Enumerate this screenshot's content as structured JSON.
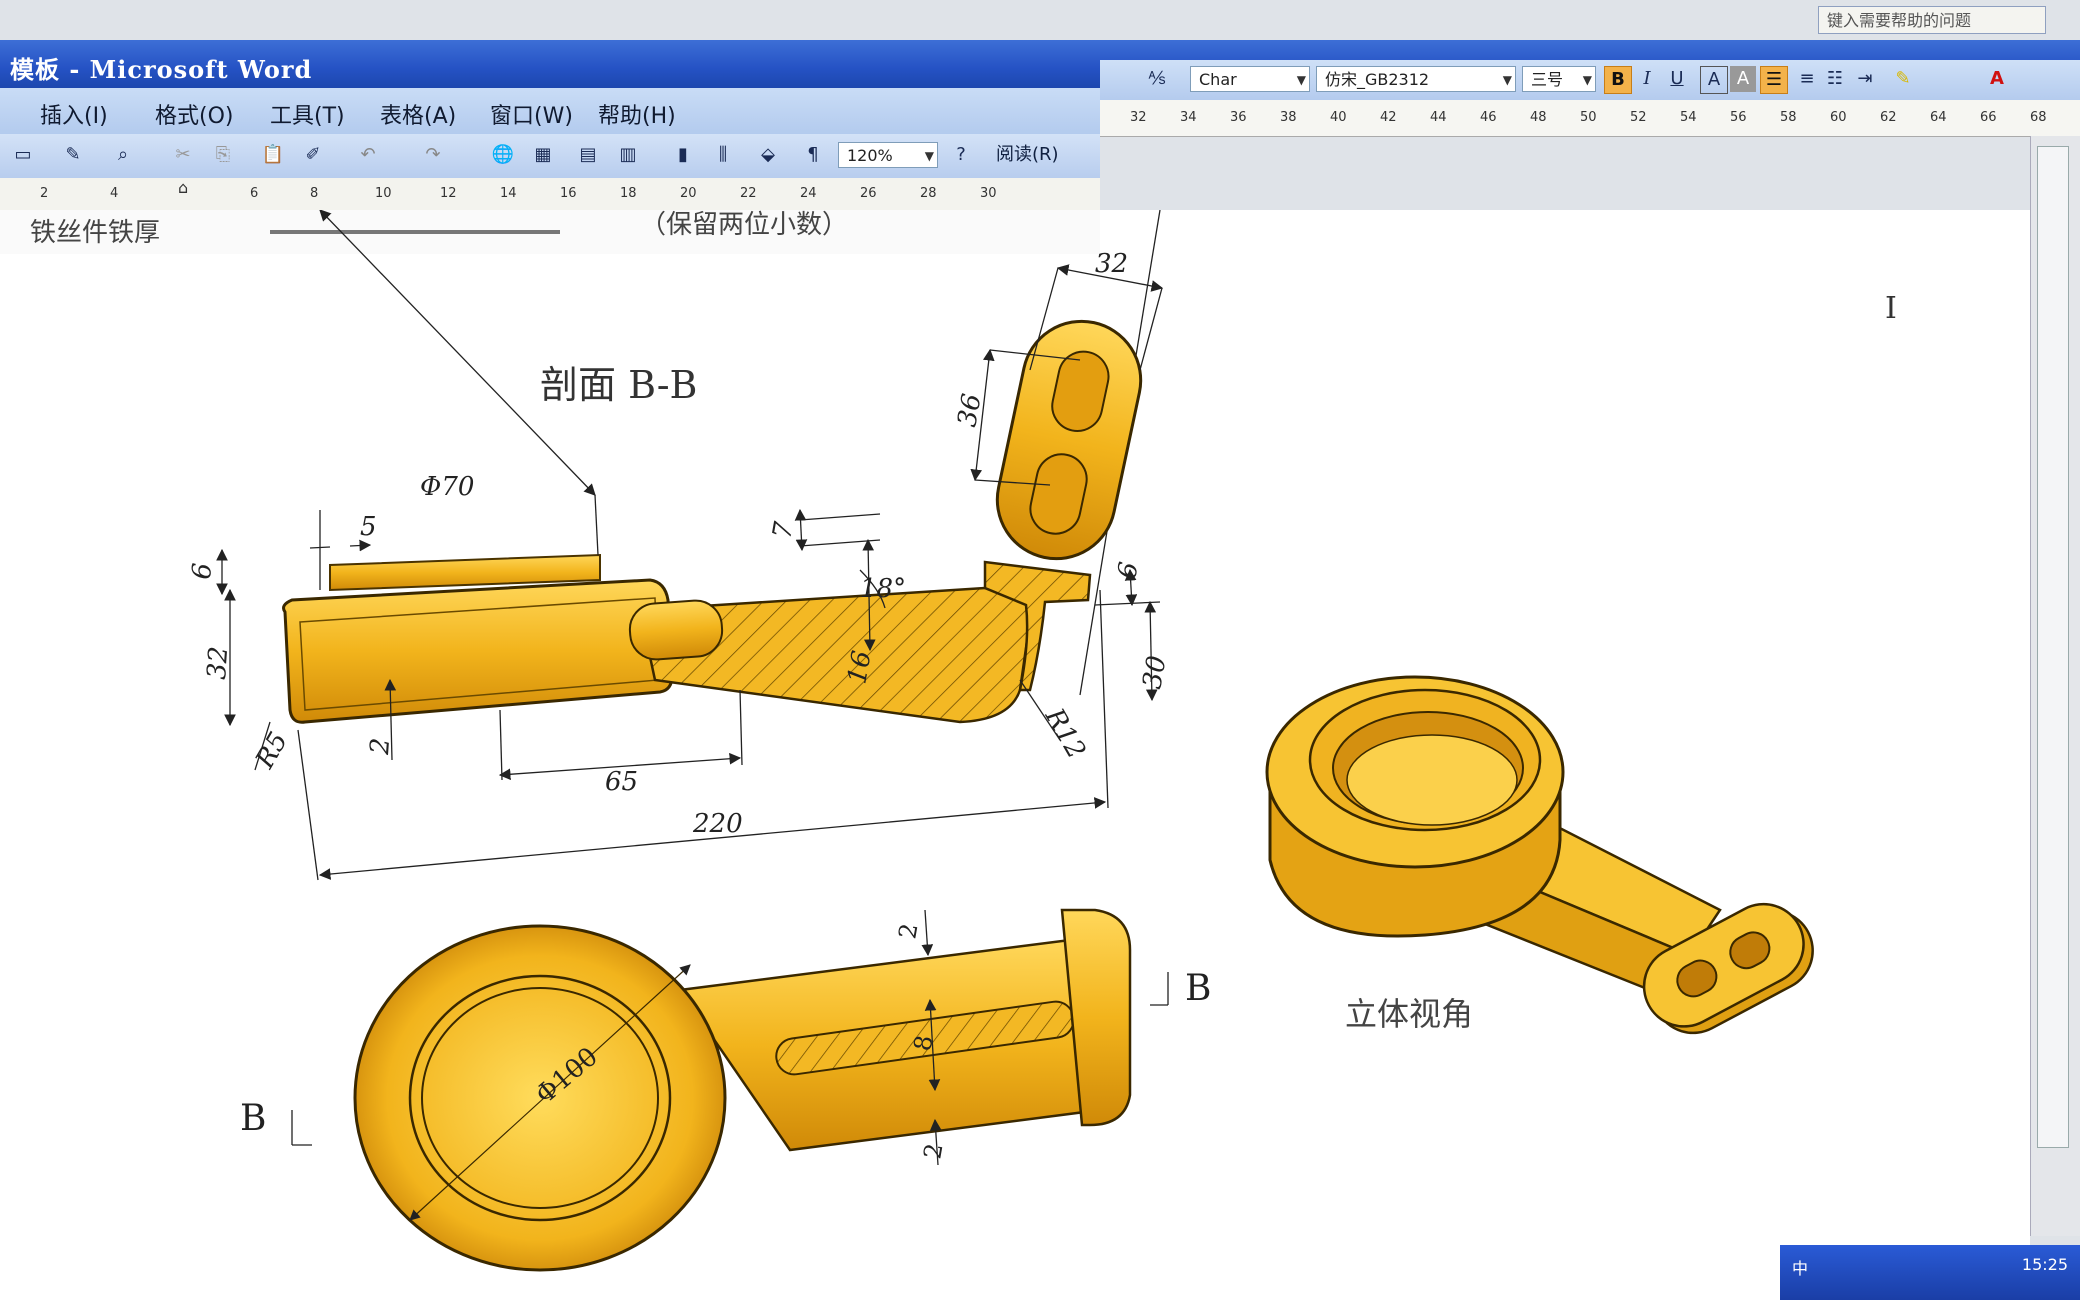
{
  "window": {
    "title": "模板 - Microsoft Word",
    "help_placeholder": "键入需要帮助的问题"
  },
  "menu": {
    "items": [
      "插入(I)",
      "格式(O)",
      "工具(T)",
      "表格(A)",
      "窗口(W)",
      "帮助(H)"
    ]
  },
  "format_toolbar": {
    "style": "Char",
    "font": "仿宋_GB2312",
    "size": "三号",
    "bold": "B",
    "italic": "I",
    "underline": "U",
    "char_border": "A",
    "char_shading": "A"
  },
  "standard_toolbar": {
    "zoom": "120%",
    "read_label": "阅读(R)"
  },
  "ruler_top": [
    "32",
    "34",
    "36",
    "38",
    "40",
    "42",
    "44",
    "46",
    "48",
    "50",
    "52",
    "54",
    "56",
    "58",
    "60",
    "62",
    "64",
    "66",
    "68"
  ],
  "ruler_left": [
    "2",
    "4",
    "6",
    "8",
    "10",
    "12",
    "14",
    "16",
    "18",
    "20",
    "22",
    "24",
    "26",
    "28",
    "30"
  ],
  "document": {
    "heading_fragment": "铁丝件铁厚",
    "note_fragment": "（保留两位小数）",
    "section_label": "剖面 B-B",
    "view_label": "立体视角",
    "cut_left": "B",
    "cut_right": "B"
  },
  "dimensions": {
    "d70": "Φ70",
    "d5": "5",
    "d6_left": "6",
    "d32_left": "32",
    "r5": "R5",
    "d2_left": "2",
    "d65": "65",
    "d220": "220",
    "d7": "7",
    "angle18": "18°",
    "d16": "16",
    "d6_right": "6",
    "d30": "30",
    "r12": "R12",
    "d32_top": "32",
    "d36": "36",
    "d100": "Φ100",
    "d2_top": "2",
    "d8": "8",
    "d2_bottom": "2"
  },
  "colors": {
    "part_fill": "#f2b41c",
    "part_dark": "#d08a08",
    "part_light": "#ffd75a"
  },
  "taskbar": {
    "ime": "中",
    "clock": "15:25"
  }
}
